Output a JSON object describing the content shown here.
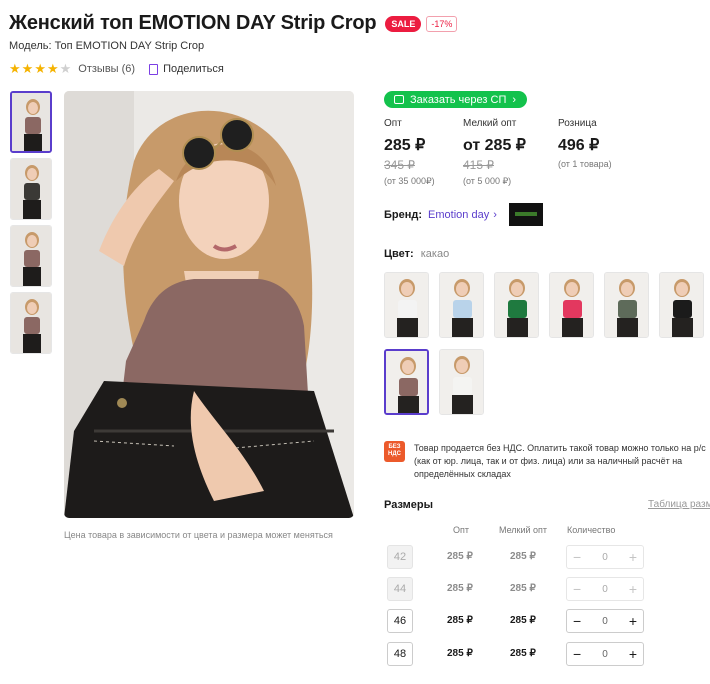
{
  "product": {
    "title": "Женский топ EMOTION DAY Strip Crop",
    "sale_badge": "SALE",
    "discount_badge": "-17%",
    "model": "Модель: Топ EMOTION DAY Strip Crop",
    "rating": 4,
    "rating_max": 5,
    "reviews": "Отзывы (6)",
    "share": "Поделиться"
  },
  "gallery": {
    "thumb_count": 4,
    "active_thumb": 0,
    "price_note": "Цена товара в зависимости от цвета и размера может меняться"
  },
  "sp_button": {
    "label": "Заказать через СП",
    "chevron": "›",
    "icon": "cart-icon"
  },
  "prices": [
    {
      "label": "Опт",
      "value": "285 ₽",
      "old": "345 ₽",
      "sub": "(от 35 000₽)"
    },
    {
      "label": "Мелкий опт",
      "value": "от 285 ₽",
      "old": "415 ₽",
      "sub": "(от 5 000 ₽)"
    },
    {
      "label": "Розница",
      "value": "496 ₽",
      "old": "",
      "sub": "(от 1 товара)"
    }
  ],
  "brand": {
    "label": "Бренд:",
    "name": "Emotion day",
    "chevron": "›"
  },
  "color": {
    "label": "Цвет:",
    "value": "какао",
    "swatch_colors": [
      "#f3f3f3",
      "#b9d3ea",
      "#1f7a3f",
      "#e3385f",
      "#5e6b5a",
      "#1b1b1b",
      "#8b6863",
      "#f4f4f2"
    ],
    "active_swatch": 6
  },
  "vat": {
    "icon_text": "БЕЗ НДС",
    "text": "Товар продается без НДС. Оплатить такой товар можно только на р/с (как от юр. лица, так и от физ. лица) или за наличный расчёт на определённых складах"
  },
  "sizes": {
    "title": "Размеры",
    "table_link": "Таблица размеров",
    "headers": {
      "opt": "Опт",
      "small_opt": "Мелкий опт",
      "qty": "Количество"
    },
    "rows": [
      {
        "size": "42",
        "opt": "285 ₽",
        "small_opt": "285 ₽",
        "qty": "0",
        "available": false
      },
      {
        "size": "44",
        "opt": "285 ₽",
        "small_opt": "285 ₽",
        "qty": "0",
        "available": false
      },
      {
        "size": "46",
        "opt": "285 ₽",
        "small_opt": "285 ₽",
        "qty": "0",
        "available": true
      },
      {
        "size": "48",
        "opt": "285 ₽",
        "small_opt": "285 ₽",
        "qty": "0",
        "available": true
      }
    ],
    "stepper_minus": "−",
    "stepper_plus": "+"
  },
  "colors": {
    "accent": "#5a3dcc",
    "green": "#13c24c",
    "sale": "#ec1c40",
    "star": "#f5b301"
  }
}
